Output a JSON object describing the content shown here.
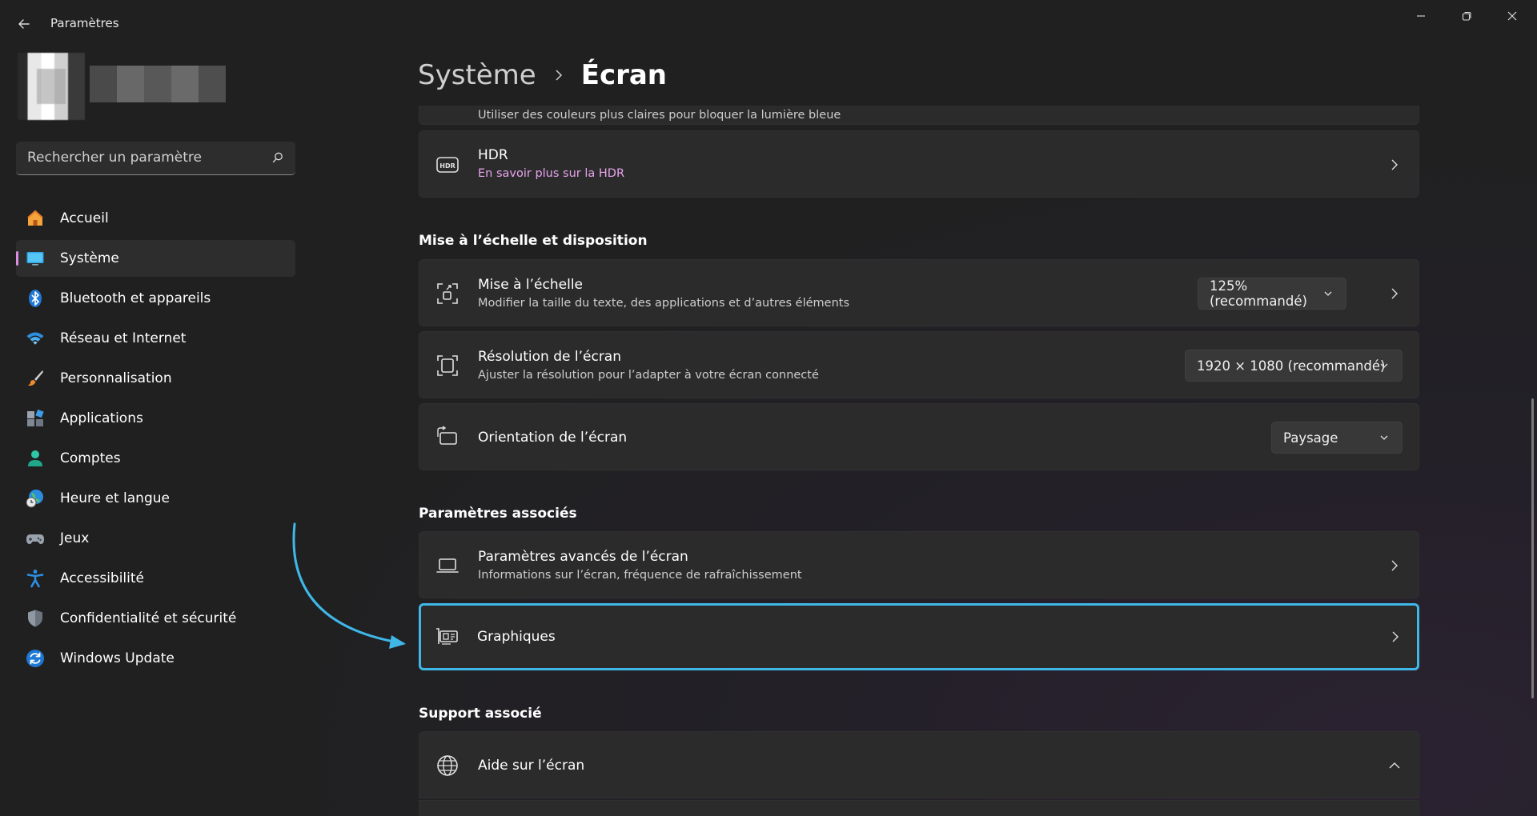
{
  "window": {
    "title": "Paramètres"
  },
  "search": {
    "placeholder": "Rechercher un paramètre"
  },
  "sidebar": {
    "items": [
      {
        "label": "Accueil",
        "icon": "home-icon"
      },
      {
        "label": "Système",
        "icon": "monitor-icon",
        "active": true
      },
      {
        "label": "Bluetooth et appareils",
        "icon": "bluetooth-icon"
      },
      {
        "label": "Réseau et Internet",
        "icon": "wifi-icon"
      },
      {
        "label": "Personnalisation",
        "icon": "brush-icon"
      },
      {
        "label": "Applications",
        "icon": "apps-icon"
      },
      {
        "label": "Comptes",
        "icon": "account-icon"
      },
      {
        "label": "Heure et langue",
        "icon": "globe-clock-icon"
      },
      {
        "label": "Jeux",
        "icon": "gamepad-icon"
      },
      {
        "label": "Accessibilité",
        "icon": "accessibility-icon"
      },
      {
        "label": "Confidentialité et sécurité",
        "icon": "shield-icon"
      },
      {
        "label": "Windows Update",
        "icon": "update-icon"
      }
    ]
  },
  "breadcrumb": {
    "parent": "Système",
    "current": "Écran"
  },
  "main": {
    "partial_row_text": "Utiliser des couleurs plus claires pour bloquer la lumière bleue",
    "hdr": {
      "title": "HDR",
      "link": "En savoir plus sur la HDR"
    },
    "section_scaling": "Mise à l’échelle et disposition",
    "scale": {
      "title": "Mise à l’échelle",
      "subtitle": "Modifier la taille du texte, des applications et d’autres éléments",
      "value": "125% (recommandé)"
    },
    "resolution": {
      "title": "Résolution de l’écran",
      "subtitle": "Ajuster la résolution pour l’adapter à  votre  écran connecté",
      "value": "1920 × 1080 (recommandé)"
    },
    "orientation": {
      "title": "Orientation de l’écran",
      "value": "Paysage"
    },
    "section_related": "Paramètres associés",
    "advanced": {
      "title": "Paramètres avancés de l’écran",
      "subtitle": "Informations sur l’écran, fréquence de rafraîchissement"
    },
    "graphics": {
      "title": "Graphiques"
    },
    "section_support": "Support associé",
    "help": {
      "title": "Aide sur l’écran"
    }
  },
  "colors": {
    "accent": "#d88fe0",
    "link": "#e7a3ec",
    "highlight_border": "#3fb8e8",
    "annotation_arrow": "#3fb8e8",
    "card_bg": "#2b2b2b"
  }
}
